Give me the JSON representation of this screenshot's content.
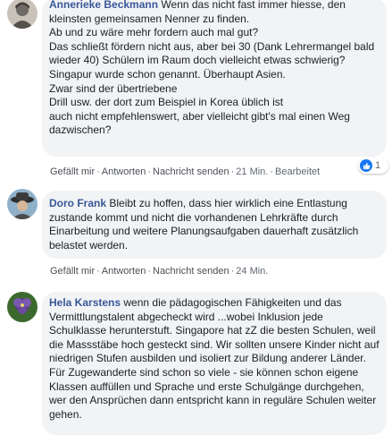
{
  "comments": [
    {
      "author": "Annerieke Beckmann",
      "text": "Wenn das nicht fast immer hiesse, den kleinsten gemeinsamen Nenner zu finden.\nAb und zu wäre mehr fordern auch mal gut?\nDas schließt fördern nicht aus, aber bei 30 (Dank Lehrermangel bald wieder 40) Schülern im Raum doch vielleicht etwas schwierig?\nSingapur wurde schon genannt. Überhaupt Asien.\nZwar sind der übertriebene\nDrill usw. der dort zum Beispiel in Korea üblich ist\nauch nicht empfehlenswert, aber vielleicht gibt's mal einen Weg dazwischen?",
      "like": "Gefällt mir",
      "reply": "Antworten",
      "message": "Nachricht senden",
      "time": "21 Min.",
      "edited": "Bearbeitet",
      "reaction_count": "1",
      "avatar_colors": [
        "#6d6a66",
        "#c9c2b8"
      ]
    },
    {
      "author": "Doro Frank",
      "text": "Bleibt zu hoffen, dass hier wirklich eine Entlastung zustande kommt und nicht die vorhandenen Lehrkräfte durch Einarbeitung und weitere Planungsaufgaben dauerhaft zusätzlich belastet werden.",
      "like": "Gefällt mir",
      "reply": "Antworten",
      "message": "Nachricht senden",
      "time": "24 Min.",
      "avatar_colors": [
        "#8fb0c9",
        "#3a3a3a"
      ]
    },
    {
      "author": "Hela Karstens",
      "text": "wenn die pädagogischen Fähigkeiten und das Vermittlungstalent abgecheckt wird ...wobei Inklusion jede Schulklasse herunterstuft. Singapore hat zZ die besten Schulen, weil die Massstäbe hoch gesteckt sind. Wir sollten unsere Kinder nicht auf niedrigen Stufen ausbilden und isoliert zur Bildung anderer Länder. Für Zugewanderte sind schon so viele - sie können schon eigene Klassen auffüllen und Sprache und erste Schulgänge durchgehen, wer den Ansprüchen dann entspricht kann in reguläre Schulen weiter gehen.",
      "avatar_colors": [
        "#5b3f8c",
        "#3c6a2e"
      ]
    }
  ],
  "separator": "·",
  "colors": {
    "author": "#385898",
    "bubble": "#f2f3f5",
    "meta": "#606770",
    "like_blue": "#1877f2"
  },
  "icons": {
    "reaction": "thumbs-up-icon"
  }
}
